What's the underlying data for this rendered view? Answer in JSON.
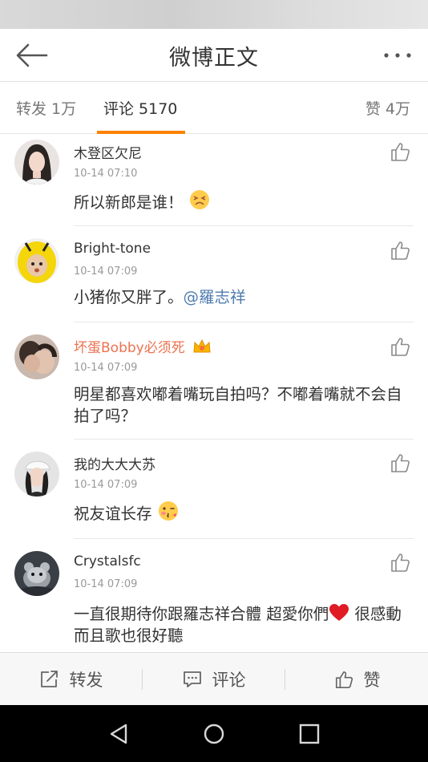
{
  "header": {
    "title": "微博正文"
  },
  "tabs": {
    "repost": "转发 1万",
    "comments": "评论 5170",
    "likes": "赞 4万"
  },
  "comments": [
    {
      "name": "木登区欠尼",
      "time": "10-14 07:10",
      "text": "所以新郎是谁！",
      "emoji": "persevere-emoji"
    },
    {
      "name": "Bright-tone",
      "time": "10-14 07:09",
      "text": "小猪你又胖了。",
      "mention": "@羅志祥"
    },
    {
      "name": "坏蛋Bobby必须死",
      "badge": "vip-crown-icon",
      "time": "10-14 07:09",
      "text": "明星都喜欢嘟着嘴玩自拍吗？不嘟着嘴就不会自拍了吗？"
    },
    {
      "name": "我的大大大苏",
      "time": "10-14 07:09",
      "text": "祝友谊长存",
      "emoji": "kiss-emoji"
    },
    {
      "name": "Crystalsfc",
      "time": "10-14 07:09",
      "text_before": "一直很期待你跟羅志祥合體 超愛你們",
      "emoji": "red-heart-emoji",
      "text_after": " 很感動 而且歌也很好聽"
    }
  ],
  "actions": {
    "repost": "转发",
    "comment": "评论",
    "like": "赞"
  },
  "colors": {
    "accent": "#ff8200",
    "vip_name": "#eb7350",
    "mention": "#507daf"
  }
}
